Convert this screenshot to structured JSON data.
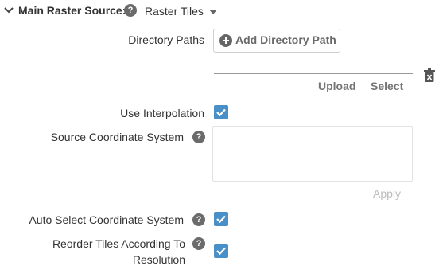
{
  "header": {
    "title": "Main Raster Source:",
    "source_select_value": "Raster Tiles"
  },
  "fields": {
    "directory_paths_label": "Directory Paths",
    "add_directory_path_label": "Add Directory Path",
    "upload_label": "Upload",
    "select_label": "Select",
    "use_interpolation_label": "Use Interpolation",
    "use_interpolation_checked": true,
    "source_crs_label": "Source Coordinate System",
    "source_crs_value": "",
    "apply_label": "Apply",
    "auto_select_crs_label": "Auto Select Coordinate System",
    "auto_select_crs_checked": true,
    "reorder_tiles_label_line1": "Reorder Tiles According To",
    "reorder_tiles_label_line2": "Resolution",
    "reorder_tiles_checked": true
  },
  "icons": {
    "collapse": "chevron-down-icon",
    "help": "help-icon",
    "dropdown": "caret-down-icon",
    "add": "plus-circle-icon",
    "delete": "delete-icon",
    "check": "check-icon"
  },
  "colors": {
    "checkbox": "#4a90c8",
    "help_icon": "#6b6b6b",
    "text": "#333333",
    "muted_button": "#757575",
    "disabled_button": "#bdbdbd"
  }
}
